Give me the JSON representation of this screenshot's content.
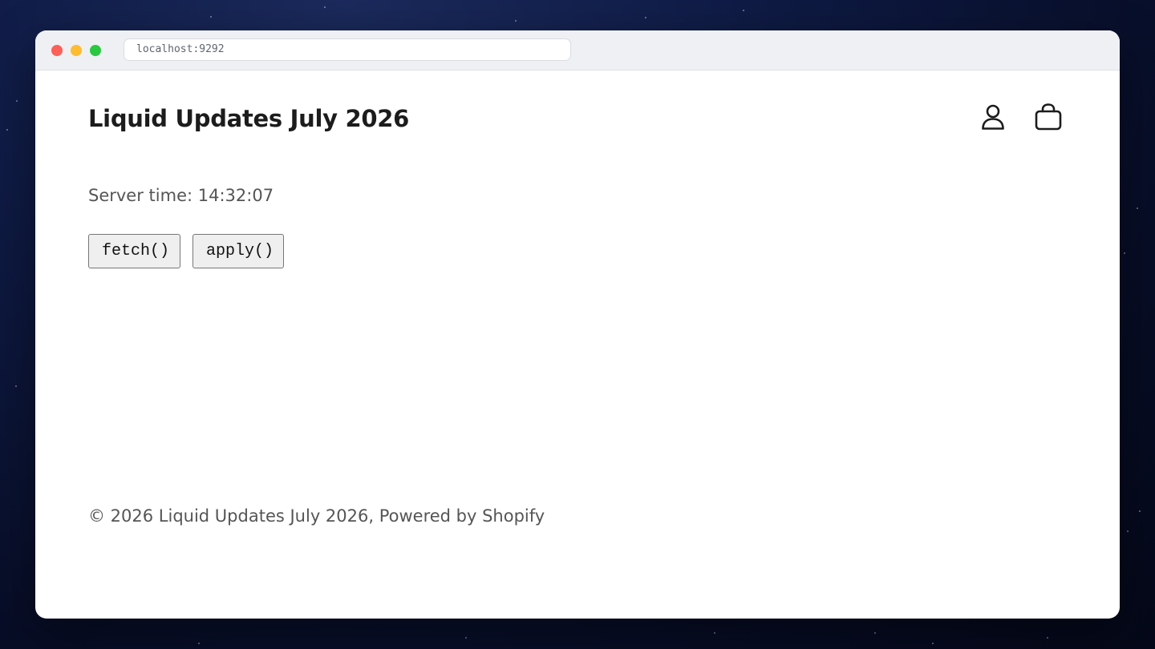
{
  "browser": {
    "url": "localhost:9292"
  },
  "header": {
    "store_title": "Liquid Updates July 2026",
    "icons": [
      "account-icon",
      "cart-icon"
    ]
  },
  "main": {
    "server_time": "Server time: 14:32:07",
    "buttons": {
      "fetch_label": "fetch()",
      "apply_label": "apply()"
    }
  },
  "footer": {
    "text": "© 2026 Liquid Updates July 2026, Powered by Shopify"
  },
  "colors": {
    "window_bg": "#ffffff",
    "titlebar_bg": "#eef0f4",
    "text_primary": "#1c1c1c",
    "text_secondary": "#555555",
    "traffic_red": "#ff5f57",
    "traffic_yellow": "#febc2e",
    "traffic_green": "#28c840"
  }
}
